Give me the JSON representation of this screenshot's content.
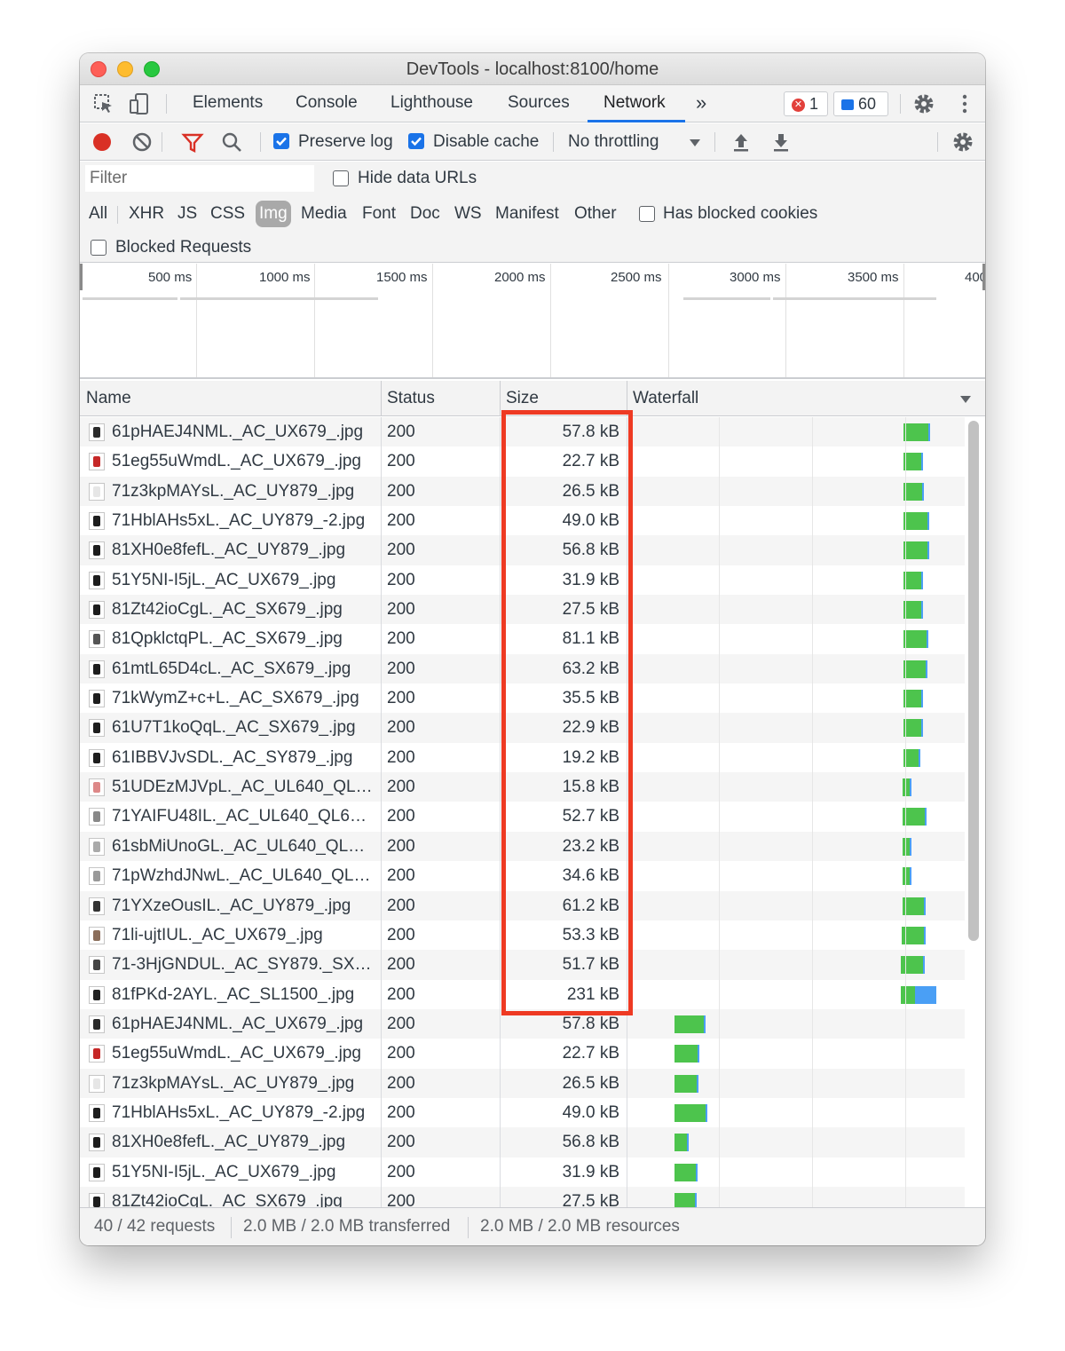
{
  "window": {
    "title": "DevTools - localhost:8100/home"
  },
  "tabs": [
    {
      "label": "Elements",
      "active": false
    },
    {
      "label": "Console",
      "active": false
    },
    {
      "label": "Lighthouse",
      "active": false
    },
    {
      "label": "Sources",
      "active": false
    },
    {
      "label": "Network",
      "active": true
    }
  ],
  "more_tabs_icon": "»",
  "badges": {
    "errors": "1",
    "messages": "60",
    "error_color": "#e2403b",
    "message_color": "#1a73e8"
  },
  "toolbar": {
    "preserve_log": {
      "label": "Preserve log",
      "checked": true
    },
    "disable_cache": {
      "label": "Disable cache",
      "checked": true
    },
    "throttling": "No throttling"
  },
  "filter": {
    "placeholder": "Filter",
    "hide_data_urls": "Hide data URLs",
    "types": [
      "All",
      "XHR",
      "JS",
      "CSS",
      "Img",
      "Media",
      "Font",
      "Doc",
      "WS",
      "Manifest",
      "Other"
    ],
    "selected_type": "Img",
    "has_blocked_cookies": "Has blocked cookies",
    "blocked_requests": "Blocked Requests"
  },
  "overview": {
    "ticks": [
      "500 ms",
      "1000 ms",
      "1500 ms",
      "2000 ms",
      "2500 ms",
      "3000 ms",
      "3500 ms",
      "400"
    ]
  },
  "columns": {
    "name": "Name",
    "status": "Status",
    "size": "Size",
    "waterfall": "Waterfall"
  },
  "requests": [
    {
      "name": "61pHAEJ4NML._AC_UX679_.jpg",
      "status": "200",
      "size": "57.8 kB",
      "wf_start_ms": 3140,
      "wf_duration_ms": 205
    },
    {
      "name": "51eg55uWmdL._AC_UX679_.jpg",
      "status": "200",
      "size": "22.7 kB",
      "wf_start_ms": 3140,
      "wf_duration_ms": 155
    },
    {
      "name": "71z3kpMAYsL._AC_UY879_.jpg",
      "status": "200",
      "size": "26.5 kB",
      "wf_start_ms": 3140,
      "wf_duration_ms": 160
    },
    {
      "name": "71HblAHs5xL._AC_UY879_-2.jpg",
      "status": "200",
      "size": "49.0 kB",
      "wf_start_ms": 3140,
      "wf_duration_ms": 200
    },
    {
      "name": "81XH0e8fefL._AC_UY879_.jpg",
      "status": "200",
      "size": "56.8 kB",
      "wf_start_ms": 3140,
      "wf_duration_ms": 200
    },
    {
      "name": "51Y5NI-I5jL._AC_UX679_.jpg",
      "status": "200",
      "size": "31.9 kB",
      "wf_start_ms": 3140,
      "wf_duration_ms": 150
    },
    {
      "name": "81Zt42ioCgL._AC_SX679_.jpg",
      "status": "200",
      "size": "27.5 kB",
      "wf_start_ms": 3140,
      "wf_duration_ms": 150
    },
    {
      "name": "81QpklctqPL._AC_SX679_.jpg",
      "status": "200",
      "size": "81.1 kB",
      "wf_start_ms": 3140,
      "wf_duration_ms": 195
    },
    {
      "name": "61mtL65D4cL._AC_SX679_.jpg",
      "status": "200",
      "size": "63.2 kB",
      "wf_start_ms": 3140,
      "wf_duration_ms": 185
    },
    {
      "name": "71kWymZ+c+L._AC_SX679_.jpg",
      "status": "200",
      "size": "35.5 kB",
      "wf_start_ms": 3140,
      "wf_duration_ms": 150
    },
    {
      "name": "61U7T1koQqL._AC_SX679_.jpg",
      "status": "200",
      "size": "22.9 kB",
      "wf_start_ms": 3140,
      "wf_duration_ms": 155
    },
    {
      "name": "61IBBVJvSDL._AC_SY879_.jpg",
      "status": "200",
      "size": "19.2 kB",
      "wf_start_ms": 3140,
      "wf_duration_ms": 135
    },
    {
      "name": "51UDEzMJVpL._AC_UL640_QL65_ML3_.jpg",
      "status": "200",
      "size": "15.8 kB",
      "wf_start_ms": 3135,
      "wf_duration_ms": 50
    },
    {
      "name": "71YAIFU48IL._AC_UL640_QL65_ML3_.jpg",
      "status": "200",
      "size": "52.7 kB",
      "wf_start_ms": 3130,
      "wf_duration_ms": 190
    },
    {
      "name": "61sbMiUnoGL._AC_UL640_QL65_ML3_.jpg",
      "status": "200",
      "size": "23.2 kB",
      "wf_start_ms": 3130,
      "wf_duration_ms": 65
    },
    {
      "name": "71pWzhdJNwL._AC_UL640_QL65_ML3_.jpg",
      "status": "200",
      "size": "34.6 kB",
      "wf_start_ms": 3130,
      "wf_duration_ms": 65
    },
    {
      "name": "71YXzeOusIL._AC_UY879_.jpg",
      "status": "200",
      "size": "61.2 kB",
      "wf_start_ms": 3130,
      "wf_duration_ms": 185
    },
    {
      "name": "71li-ujtIUL._AC_UX679_.jpg",
      "status": "200",
      "size": "53.3 kB",
      "wf_start_ms": 3125,
      "wf_duration_ms": 190
    },
    {
      "name": "71-3HjGNDUL._AC_SY879._SX._UX._SY._UY_.jpg",
      "status": "200",
      "size": "51.7 kB",
      "wf_start_ms": 3120,
      "wf_duration_ms": 190
    },
    {
      "name": "81fPKd-2AYL._AC_SL1500_.jpg",
      "status": "200",
      "size": "231 kB",
      "wf_start_ms": 3120,
      "wf_duration_ms": 275
    },
    {
      "name": "61pHAEJ4NML._AC_UX679_.jpg",
      "status": "200",
      "size": "57.8 kB",
      "wf_start_ms": 1350,
      "wf_duration_ms": 240
    },
    {
      "name": "51eg55uWmdL._AC_UX679_.jpg",
      "status": "200",
      "size": "22.7 kB",
      "wf_start_ms": 1350,
      "wf_duration_ms": 195
    },
    {
      "name": "71z3kpMAYsL._AC_UY879_.jpg",
      "status": "200",
      "size": "26.5 kB",
      "wf_start_ms": 1350,
      "wf_duration_ms": 190
    },
    {
      "name": "71HblAHs5xL._AC_UY879_-2.jpg",
      "status": "200",
      "size": "49.0 kB",
      "wf_start_ms": 1350,
      "wf_duration_ms": 255
    },
    {
      "name": "81XH0e8fefL._AC_UY879_.jpg",
      "status": "200",
      "size": "56.8 kB",
      "wf_start_ms": 1350,
      "wf_duration_ms": 110
    },
    {
      "name": "51Y5NI-I5jL._AC_UX679_.jpg",
      "status": "200",
      "size": "31.9 kB",
      "wf_start_ms": 1350,
      "wf_duration_ms": 180
    },
    {
      "name": "81Zt42ioCgL._AC_SX679_.jpg",
      "status": "200",
      "size": "27.5 kB",
      "wf_start_ms": 1350,
      "wf_duration_ms": 175
    }
  ],
  "highlight_color": "#ee3a23",
  "status": {
    "requests": "40 / 42 requests",
    "transferred": "2.0 MB / 2.0 MB transferred",
    "resources": "2.0 MB / 2.0 MB resources"
  }
}
